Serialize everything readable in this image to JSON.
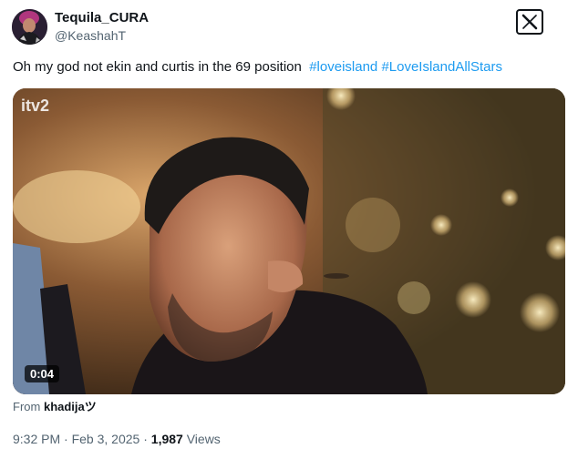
{
  "header": {
    "display_name": "Tequila_CURA",
    "handle": "@KeashahT",
    "avatar_icon": "user-avatar",
    "logo_icon": "x-logo-icon"
  },
  "tweet": {
    "text": "Oh my god not ekin and curtis in the 69 position",
    "hashtags": [
      "#loveisland",
      "#LoveIslandAllStars"
    ]
  },
  "media": {
    "watermark": "itv2",
    "duration": "0:04",
    "from_label": "From",
    "from_user": "khadijaツ"
  },
  "meta": {
    "time": "9:32 PM",
    "separator": "·",
    "date": "Feb 3, 2025",
    "views_count": "1,987",
    "views_label": "Views"
  },
  "colors": {
    "link": "#1d9bf0",
    "secondary_text": "#536471",
    "primary_text": "#0f1419"
  }
}
